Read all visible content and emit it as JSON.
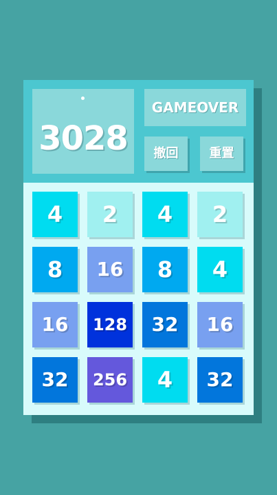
{
  "score": {
    "value": "3028"
  },
  "status": {
    "label": "GAMEOVER"
  },
  "buttons": {
    "undo_label": "撤回",
    "reset_label": "重置"
  },
  "colors": {
    "background": "#46a3a3",
    "header": "#4cc7d0",
    "panel": "#8ad8da",
    "board": "#d8fbfb",
    "tile_2": "#a0f0f0",
    "tile_4": "#00dcf0",
    "tile_8": "#00a9f0",
    "tile_16": "#78a0f0",
    "tile_32": "#0276dc",
    "tile_128": "#0032dc",
    "tile_256": "#6458dc"
  },
  "board": {
    "rows": [
      [
        "4",
        "2",
        "4",
        "2"
      ],
      [
        "8",
        "16",
        "8",
        "4"
      ],
      [
        "16",
        "128",
        "32",
        "16"
      ],
      [
        "32",
        "256",
        "4",
        "32"
      ]
    ]
  }
}
